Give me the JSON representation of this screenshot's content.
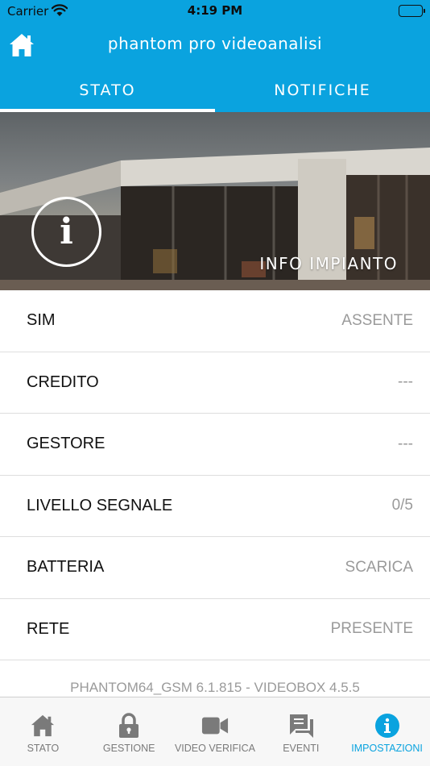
{
  "status_bar": {
    "carrier": "Carrier",
    "time": "4:19 PM"
  },
  "nav": {
    "title": "phantom pro videoanalisi",
    "home_icon": "home-icon"
  },
  "tabs": [
    {
      "label": "STATO",
      "active": true
    },
    {
      "label": "NOTIFICHE",
      "active": false
    }
  ],
  "hero": {
    "label": "INFO IMPIANTO",
    "info_glyph": "i"
  },
  "rows": [
    {
      "label": "SIM",
      "value": "ASSENTE"
    },
    {
      "label": "CREDITO",
      "value": "---"
    },
    {
      "label": "GESTORE",
      "value": "---"
    },
    {
      "label": "LIVELLO SEGNALE",
      "value": "0/5"
    },
    {
      "label": "BATTERIA",
      "value": "SCARICA"
    },
    {
      "label": "RETE",
      "value": "PRESENTE"
    }
  ],
  "version": "PHANTOM64_GSM 6.1.815 - VIDEOBOX 4.5.5",
  "tab_bar": [
    {
      "label": "STATO",
      "icon": "home-icon",
      "active": false
    },
    {
      "label": "GESTIONE",
      "icon": "lock-icon",
      "active": false
    },
    {
      "label": "VIDEO VERIFICA",
      "icon": "video-camera-icon",
      "active": false
    },
    {
      "label": "EVENTI",
      "icon": "chat-bubbles-icon",
      "active": false
    },
    {
      "label": "IMPOSTAZIONI",
      "icon": "info-icon",
      "active": true
    }
  ],
  "colors": {
    "accent": "#0aa3df",
    "value_gray": "#9a9a9a",
    "tab_gray": "#7a7a7a"
  }
}
